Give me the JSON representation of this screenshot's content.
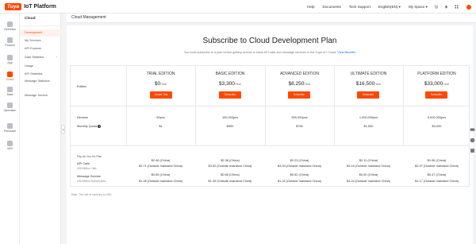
{
  "brand": {
    "logo_text": "Tuya",
    "product": "IoT Platform"
  },
  "topnav": {
    "items": [
      "Help",
      "Documents",
      "Tech Support",
      "English(EN)",
      "My Space"
    ],
    "accent": "#ff4800"
  },
  "rail": [
    {
      "label": "Overview",
      "icon": "home-icon"
    },
    {
      "label": "Product",
      "icon": "box-icon"
    },
    {
      "label": "App",
      "icon": "phone-icon"
    },
    {
      "label": "Cloud",
      "icon": "cloud-icon",
      "active": true
    },
    {
      "label": "Data",
      "icon": "chart-icon"
    },
    {
      "label": "Operation",
      "icon": "operation-icon"
    },
    {
      "label": "Purchase",
      "icon": "cart-icon"
    },
    {
      "label": "VAS",
      "icon": "vas-icon"
    }
  ],
  "subnav": {
    "title": "Cloud",
    "items": [
      "Development",
      "My Services",
      "API Explorer",
      "Data Statistics",
      "Usage",
      "API Statistics",
      "Message Statistics",
      "Message Service"
    ]
  },
  "breadcrumb": "Cloud Management",
  "page": {
    "title": "Subscribe to Cloud Development Plan",
    "subtitle": "You must subscribe to a plan before getting access to basic API calls and message services in the Tuya IoT Cloud.",
    "subtitle_link": "View Benefits"
  },
  "table": {
    "edition_label": "Edition",
    "devices_label": "Devices",
    "quota_label": "Monthly Quota",
    "payg_label": "Pay-As-You-Go Plan",
    "api_calls_label": "API Calls",
    "api_calls_unit": "USD/Million Calls",
    "message_label": "Message Service",
    "message_unit": "USD/Million Subscriptions",
    "price_unit": "/Year",
    "editions": [
      {
        "name": "TRIAL EDITION",
        "price": "$0",
        "button": "Create Trial",
        "devices": "50pcs",
        "quota": "$1",
        "api_cn": "$2.46 (China)",
        "api_out": "$3.71 (Outside mainland China)",
        "msg_cn": "$0.69 (China)",
        "msg_out": "$1.46 (Outside mainland China)"
      },
      {
        "name": "BASIC EDITION",
        "price": "$3,300",
        "button": "Subscribe",
        "devices": "100,000pcs",
        "quota": "$500",
        "api_cn": "$2.38 (China)",
        "api_out": "$3.52 (Outside mainland China)",
        "msg_cn": "$0.65 (China)",
        "msg_out": "$1.39 (Outside mainland China)"
      },
      {
        "name": "ADVANCED EDITION",
        "price": "$8,250",
        "button": "Subscribe",
        "devices": "500,000pcs",
        "quota": "$750",
        "api_cn": "$2.23 (China)",
        "api_out": "$3.34 (Outside mainland China)",
        "msg_cn": "$0.52 (China)",
        "msg_out": "$1.32 (Outside mainland China)"
      },
      {
        "name": "ULTIMATE EDITION",
        "price": "$16,500",
        "button": "Subscribe",
        "devices": "1,000,000pcs",
        "quota": "$1,500",
        "api_cn": "$2.11 (China)",
        "api_out": "$3.15 (Outside mainland China)",
        "msg_cn": "$0.50 (China)",
        "msg_out": "$1.24 (Outside mainland China)"
      },
      {
        "name": "PLATFORM EDITION",
        "price": "$33,000",
        "button": "Subscribe",
        "devices": "5,000,000pcs",
        "quota": "$3,000",
        "api_cn": "$1.96 (China)",
        "api_out": "$2.97 (Outside mainland China)",
        "msg_cn": "$0.47 (China)",
        "msg_out": "$1.17 (Outside mainland China)"
      }
    ]
  },
  "note": "Note: The unit of currency is USD."
}
